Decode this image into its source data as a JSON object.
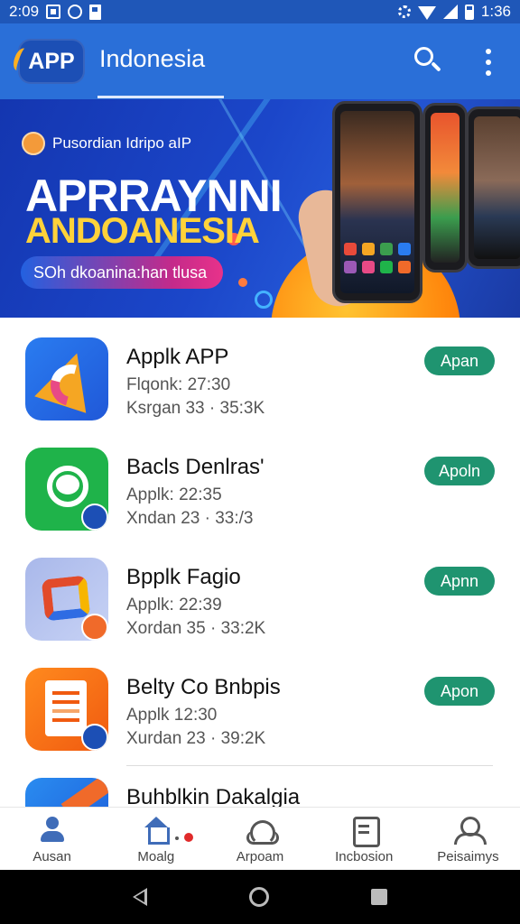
{
  "status_bar": {
    "time": "2:09",
    "battery_text": "1:36"
  },
  "app_bar": {
    "logo_text": "APP",
    "title": "Indonesia"
  },
  "banner": {
    "subtitle": "Pusordian Idripo aIP",
    "headline": "APRRAYNNI",
    "headline2": "ANDOANESIA",
    "button_label": "SOh dkoanina:han tlusa"
  },
  "apps": [
    {
      "name": "Applk APP",
      "line1": "Flqonk: 27:30",
      "line2": "Ksrgan 33 · 35:3K",
      "button": "Apan"
    },
    {
      "name": "Bacls Denlras'",
      "line1": "Applk: 22:35",
      "line2": "Xndan 23 · 33:/3",
      "button": "Apoln"
    },
    {
      "name": "Bpplk Fagio",
      "line1": "Applk: 22:39",
      "line2": "Xordan 35 · 33:2K",
      "button": "Apnn"
    },
    {
      "name": "Belty Co Bnbpis",
      "line1": "Applk 12:30",
      "line2": "Xurdan 23 · 39:2K",
      "button": "Apon"
    },
    {
      "name": "Buhblkin Dakalgia",
      "line1": "",
      "line2": "",
      "button": ""
    }
  ],
  "bottom_nav": [
    {
      "label": "Ausan",
      "icon": "people-icon"
    },
    {
      "label": "Moalg",
      "icon": "home-icon"
    },
    {
      "label": "Arpoam",
      "icon": "cloud-icon"
    },
    {
      "label": "Incbosion",
      "icon": "box-icon"
    },
    {
      "label": "Peisaimys",
      "icon": "user-icon"
    }
  ],
  "colors": {
    "status_bar": "#1f57b8",
    "app_bar": "#2a6fd8",
    "button": "#1f9470"
  }
}
